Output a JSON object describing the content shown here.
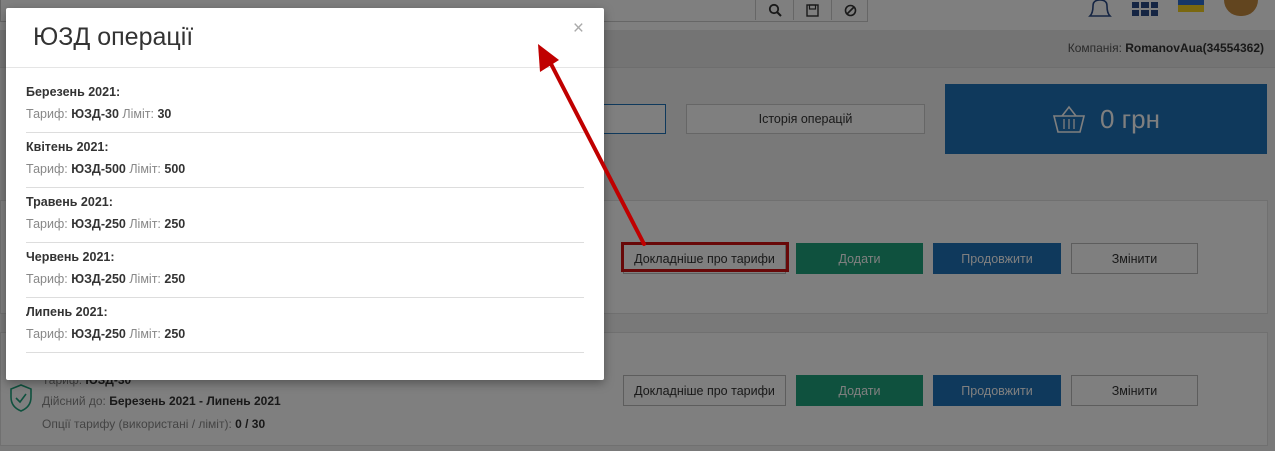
{
  "header": {
    "company_label": "Компанія:",
    "company_name": "RomanovAua(34554362)"
  },
  "actions": {
    "history_label": "Історія операцій",
    "balance": "0 грн"
  },
  "card1": {
    "details": "Докладніше про тарифи",
    "add": "Додати",
    "extend": "Продовжити",
    "change": "Змінити"
  },
  "card2": {
    "tariff_label": "Тариф:",
    "tariff_value": "ЮЗД-30",
    "valid_label": "Дійсний до:",
    "valid_value": "Березень 2021 - Липень 2021",
    "options_label": "Опції тарифу (використані / ліміт):",
    "options_value": "0 / 30",
    "details": "Докладніше про тарифи",
    "add": "Додати",
    "extend": "Продовжити",
    "change": "Змінити"
  },
  "modal": {
    "title": "ЮЗД операції",
    "close": "×",
    "tariff_label": "Тариф:",
    "limit_label": "Ліміт:",
    "entries": [
      {
        "month": "Березень 2021:",
        "tariff": "ЮЗД-30",
        "limit": "30"
      },
      {
        "month": "Квітень 2021:",
        "tariff": "ЮЗД-500",
        "limit": "500"
      },
      {
        "month": "Травень 2021:",
        "tariff": "ЮЗД-250",
        "limit": "250"
      },
      {
        "month": "Червень 2021:",
        "tariff": "ЮЗД-250",
        "limit": "250"
      },
      {
        "month": "Липень 2021:",
        "tariff": "ЮЗД-250",
        "limit": "250"
      }
    ]
  },
  "colors": {
    "primary": "#1e73b8",
    "success": "#1fa27d",
    "annotation": "#d01010"
  },
  "icons": [
    "search-icon",
    "save-icon",
    "block-icon",
    "bell-icon",
    "apps-grid-icon",
    "ukraine-flag-icon",
    "basket-icon",
    "shield-check-icon",
    "close-icon"
  ]
}
